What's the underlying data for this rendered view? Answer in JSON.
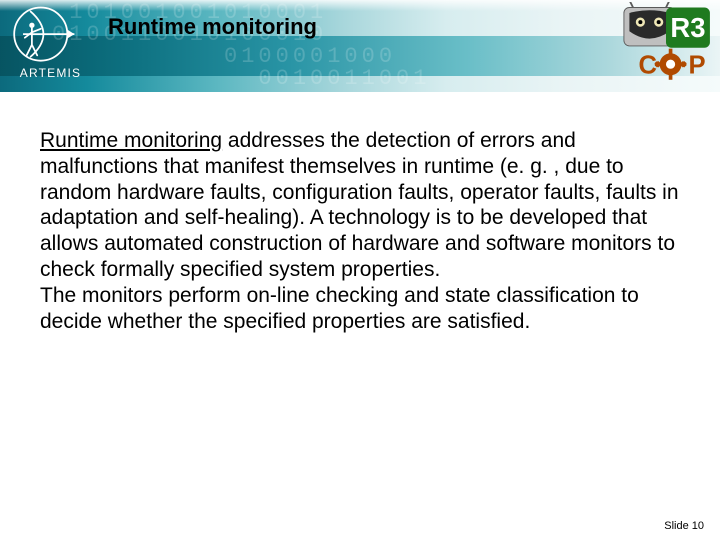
{
  "header": {
    "title": "Runtime monitoring",
    "artemis_label": "ARTEMIS",
    "binary_bg": " 101001001010001\n0100110010100010\n          0100001000\n            0010011001"
  },
  "body": {
    "lead": "Runtime monitoring",
    "para1_rest": " addresses the detection of errors and malfunctions that manifest themselves in runtime (e. g. , due to random hardware faults, configuration faults, operator faults, faults in adaptation and self-healing). A technology is to be developed that allows automated construction of hardware and software monitors to check formally specified system properties.",
    "para2": "The monitors perform on-line checking and state classification to decide whether the specified properties are satisfied."
  },
  "footer": {
    "slide_label": "Slide 10"
  },
  "logos": {
    "artemis": "artemis-archer-logo",
    "r3cop": "r3-cop-robot-logo",
    "r3_text": "R3",
    "cop_c": "C",
    "cop_p": "P"
  }
}
